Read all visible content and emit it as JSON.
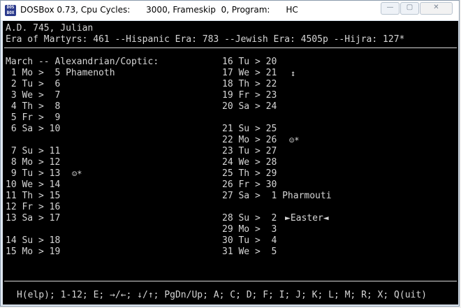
{
  "window": {
    "title": "DOSBox 0.73, Cpu Cycles:      3000, Frameskip  0, Program:      HC",
    "app_icon_text": "DOS BOX",
    "min_glyph": "—",
    "max_glyph": "▢",
    "close_glyph": "✕"
  },
  "header": {
    "line1": "A.D. 745, Julian",
    "line2": "Era of Martyrs: 461 --Hispanic Era: 783 --Jewish Era: 4505p --Hijra: 127*"
  },
  "left_column": {
    "heading": "March -- Alexandrian/Coptic:",
    "rows": [
      " 1 Mo >  5 Phamenoth",
      " 2 Tu >  6",
      " 3 We >  7",
      " 4 Th >  8",
      " 5 Fr >  9",
      " 6 Sa > 10",
      " 7 Su > 11",
      " 8 Mo > 12",
      " 9 Tu > 13",
      "10 We > 14",
      "11 Th > 15",
      "12 Fr > 16",
      "13 Sa > 17",
      "14 Su > 18",
      "15 Mo > 19"
    ],
    "marks": {
      "row9": "☺*"
    }
  },
  "right_column": {
    "rows": [
      "16 Tu > 20",
      "17 We > 21",
      "18 Th > 22",
      "19 Fr > 23",
      "20 Sa > 24",
      "21 Su > 25",
      "22 Mo > 26",
      "23 Tu > 27",
      "24 We > 28",
      "25 Th > 29",
      "26 Fr > 30",
      "27 Sa >  1 Pharmouti",
      "28 Su >  2",
      "29 Mo >  3",
      "30 Tu >  4",
      "31 We >  5"
    ],
    "marks": {
      "row17": "↕",
      "row22": "☺*",
      "row28": "►Easter◄"
    }
  },
  "footer": {
    "help": "H(elp); 1-12; E; →/←; ↓/↑; PgDn/Up; A; C; D; F; I; J; K; L; M; R; X; Q(uit)"
  }
}
